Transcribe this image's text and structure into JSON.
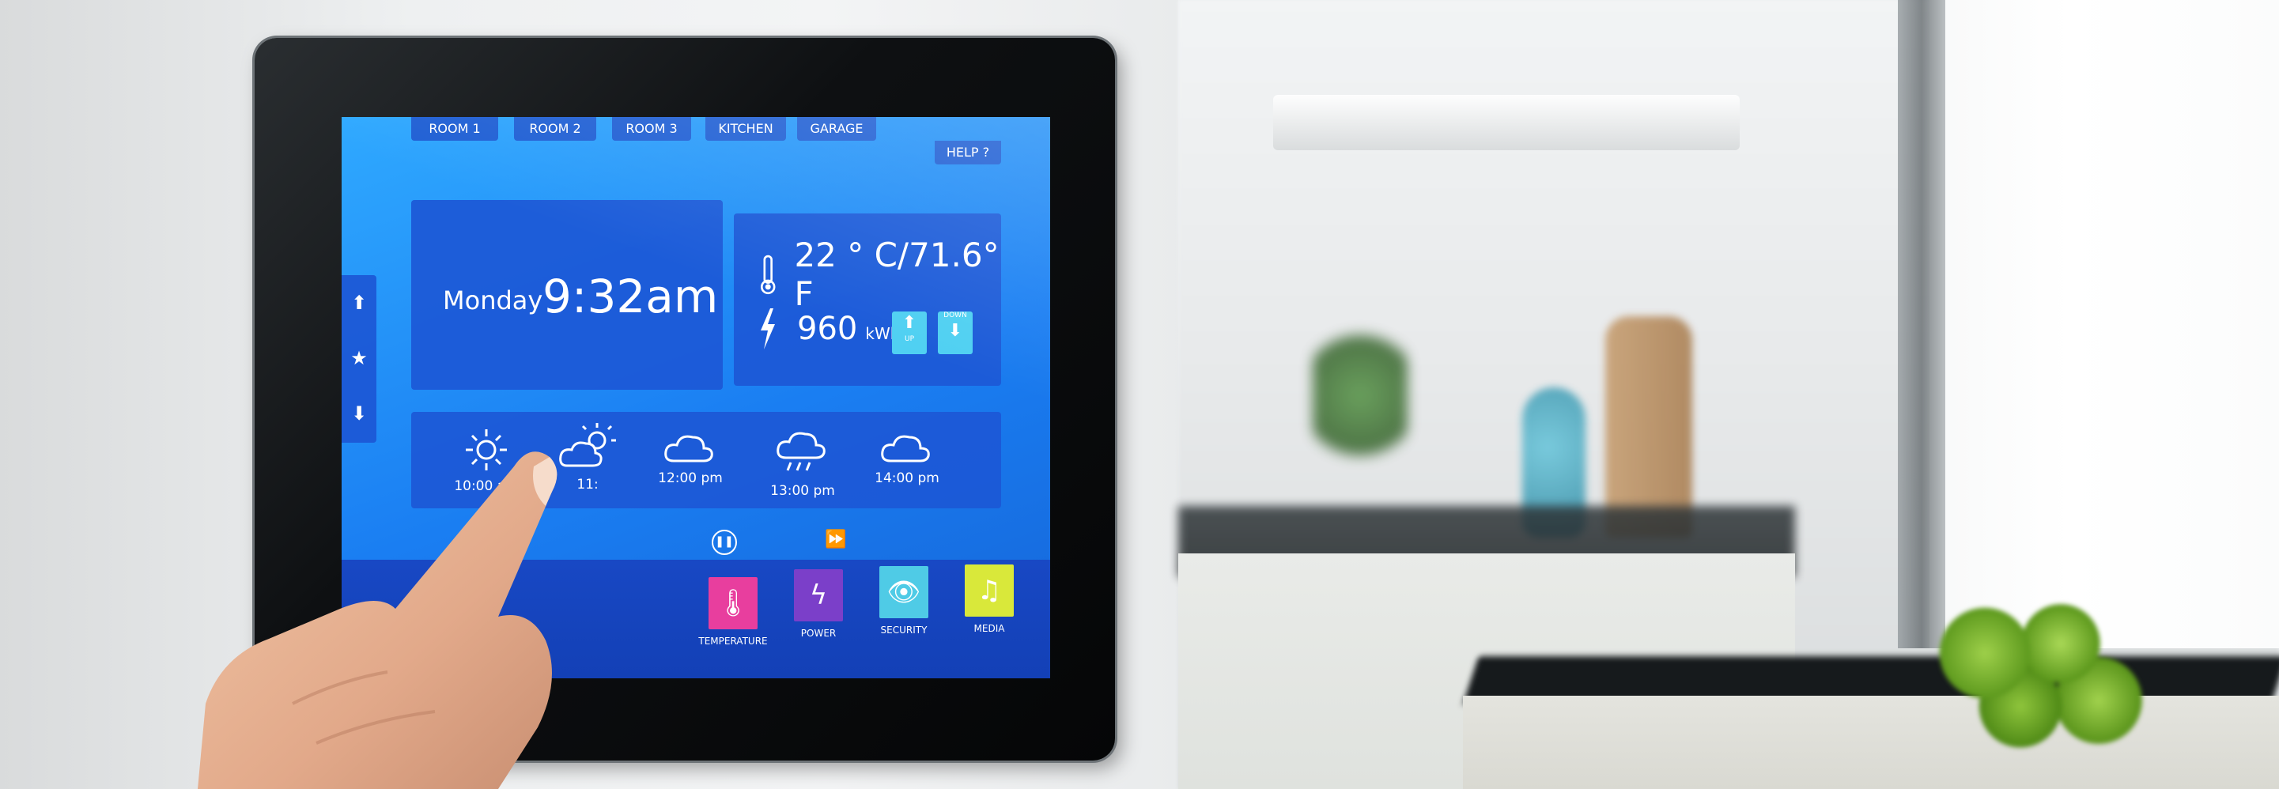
{
  "tablet": {
    "tabs": [
      {
        "label": "ROOM 1"
      },
      {
        "label": "ROOM 2"
      },
      {
        "label": "ROOM 3"
      },
      {
        "label": "KITCHEN"
      },
      {
        "label": "GARAGE"
      }
    ],
    "help_label": "HELP ?",
    "clock": {
      "day": "Monday",
      "time": "9:32am"
    },
    "temperature": {
      "value": "22 ° C/71.6° F",
      "icon": "thermometer-icon"
    },
    "power": {
      "value": "960",
      "unit": "kWh",
      "icon": "lightning-icon",
      "up_label": "UP",
      "down_label": "DOWN"
    },
    "weather": [
      {
        "time": "10:00 am",
        "icon": "sun-icon"
      },
      {
        "time": "11:",
        "icon": "partly-cloudy-icon"
      },
      {
        "time": "12:00 pm",
        "icon": "cloud-icon"
      },
      {
        "time": "13:00 pm",
        "icon": "rain-cloud-icon"
      },
      {
        "time": "14:00 pm",
        "icon": "cloud-icon"
      }
    ],
    "side_nav": [
      "up-arrow-icon",
      "star-icon",
      "down-arrow-icon"
    ],
    "playback": [
      "pause-icon",
      "fast-forward-icon"
    ],
    "apps": [
      {
        "label": "TEMPERATURE",
        "icon": "thermometer-icon",
        "color": "#e83e9e"
      },
      {
        "label": "POWER",
        "icon": "lightning-icon",
        "color": "#7b3fc9"
      },
      {
        "label": "SECURITY",
        "icon": "eye-icon",
        "color": "#4fcbe6"
      },
      {
        "label": "MEDIA",
        "icon": "music-icon",
        "color": "#d9e83a"
      }
    ]
  },
  "colors": {
    "screen": "#1a7ef2",
    "panel": "#1c58d6",
    "dock": "#1848c4",
    "bezel": "#0e1012"
  }
}
